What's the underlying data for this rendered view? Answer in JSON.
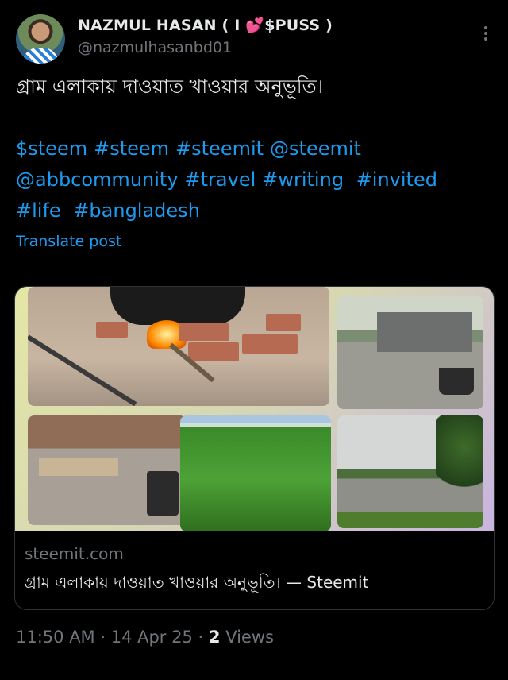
{
  "author": {
    "name": "NAZMUL HASAN ( I 💕$PUSS )",
    "handle": "@nazmulhasanbd01"
  },
  "post": {
    "text": "গ্রাম এলাকায় দাওয়াত খাওয়ার অনুভূতি।",
    "tags": [
      "$steem",
      "#steem",
      "#steemit",
      "@steemit",
      "@abbcommunity",
      "#travel",
      "#writing",
      "#invited",
      "#life",
      "#bangladesh"
    ],
    "translate_label": "Translate post"
  },
  "card": {
    "domain": "steemit.com",
    "title": "গ্রাম এলাকায় দাওয়াত খাওয়ার অনুভূতি। — Steemit"
  },
  "footer": {
    "time": "11:50 AM",
    "date": "14 Apr 25",
    "views_count": "2",
    "views_label": "Views"
  },
  "colors": {
    "background": "#000000",
    "link": "#1d9bf0",
    "muted": "#71767b",
    "text": "#e7e9ea"
  }
}
